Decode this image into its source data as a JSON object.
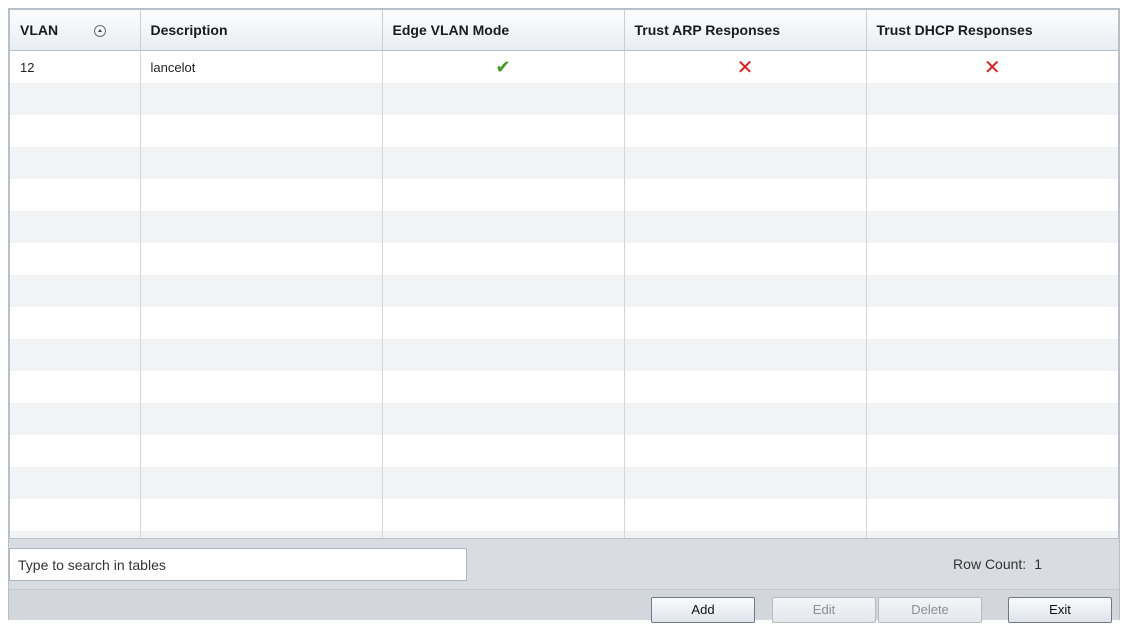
{
  "table": {
    "columns": {
      "vlan": "VLAN",
      "description": "Description",
      "edge_vlan_mode": "Edge VLAN Mode",
      "trust_arp": "Trust ARP Responses",
      "trust_dhcp": "Trust DHCP Responses"
    },
    "rows": [
      {
        "vlan": "12",
        "description": "lancelot",
        "edge_vlan_mode": "✔",
        "trust_arp": "✕",
        "trust_dhcp": "✕"
      }
    ],
    "status_colors": {
      "enabled": "#3f9b1e",
      "disabled": "#e11c1c"
    }
  },
  "search": {
    "placeholder": "Type to search in tables"
  },
  "row_count": {
    "label": "Row Count:",
    "value": "1"
  },
  "buttons": {
    "add": "Add",
    "edit": "Edit",
    "delete": "Delete",
    "exit": "Exit"
  },
  "icons": {
    "sort": "sort-ascending-icon",
    "check": "check-icon",
    "cross": "cross-icon"
  }
}
